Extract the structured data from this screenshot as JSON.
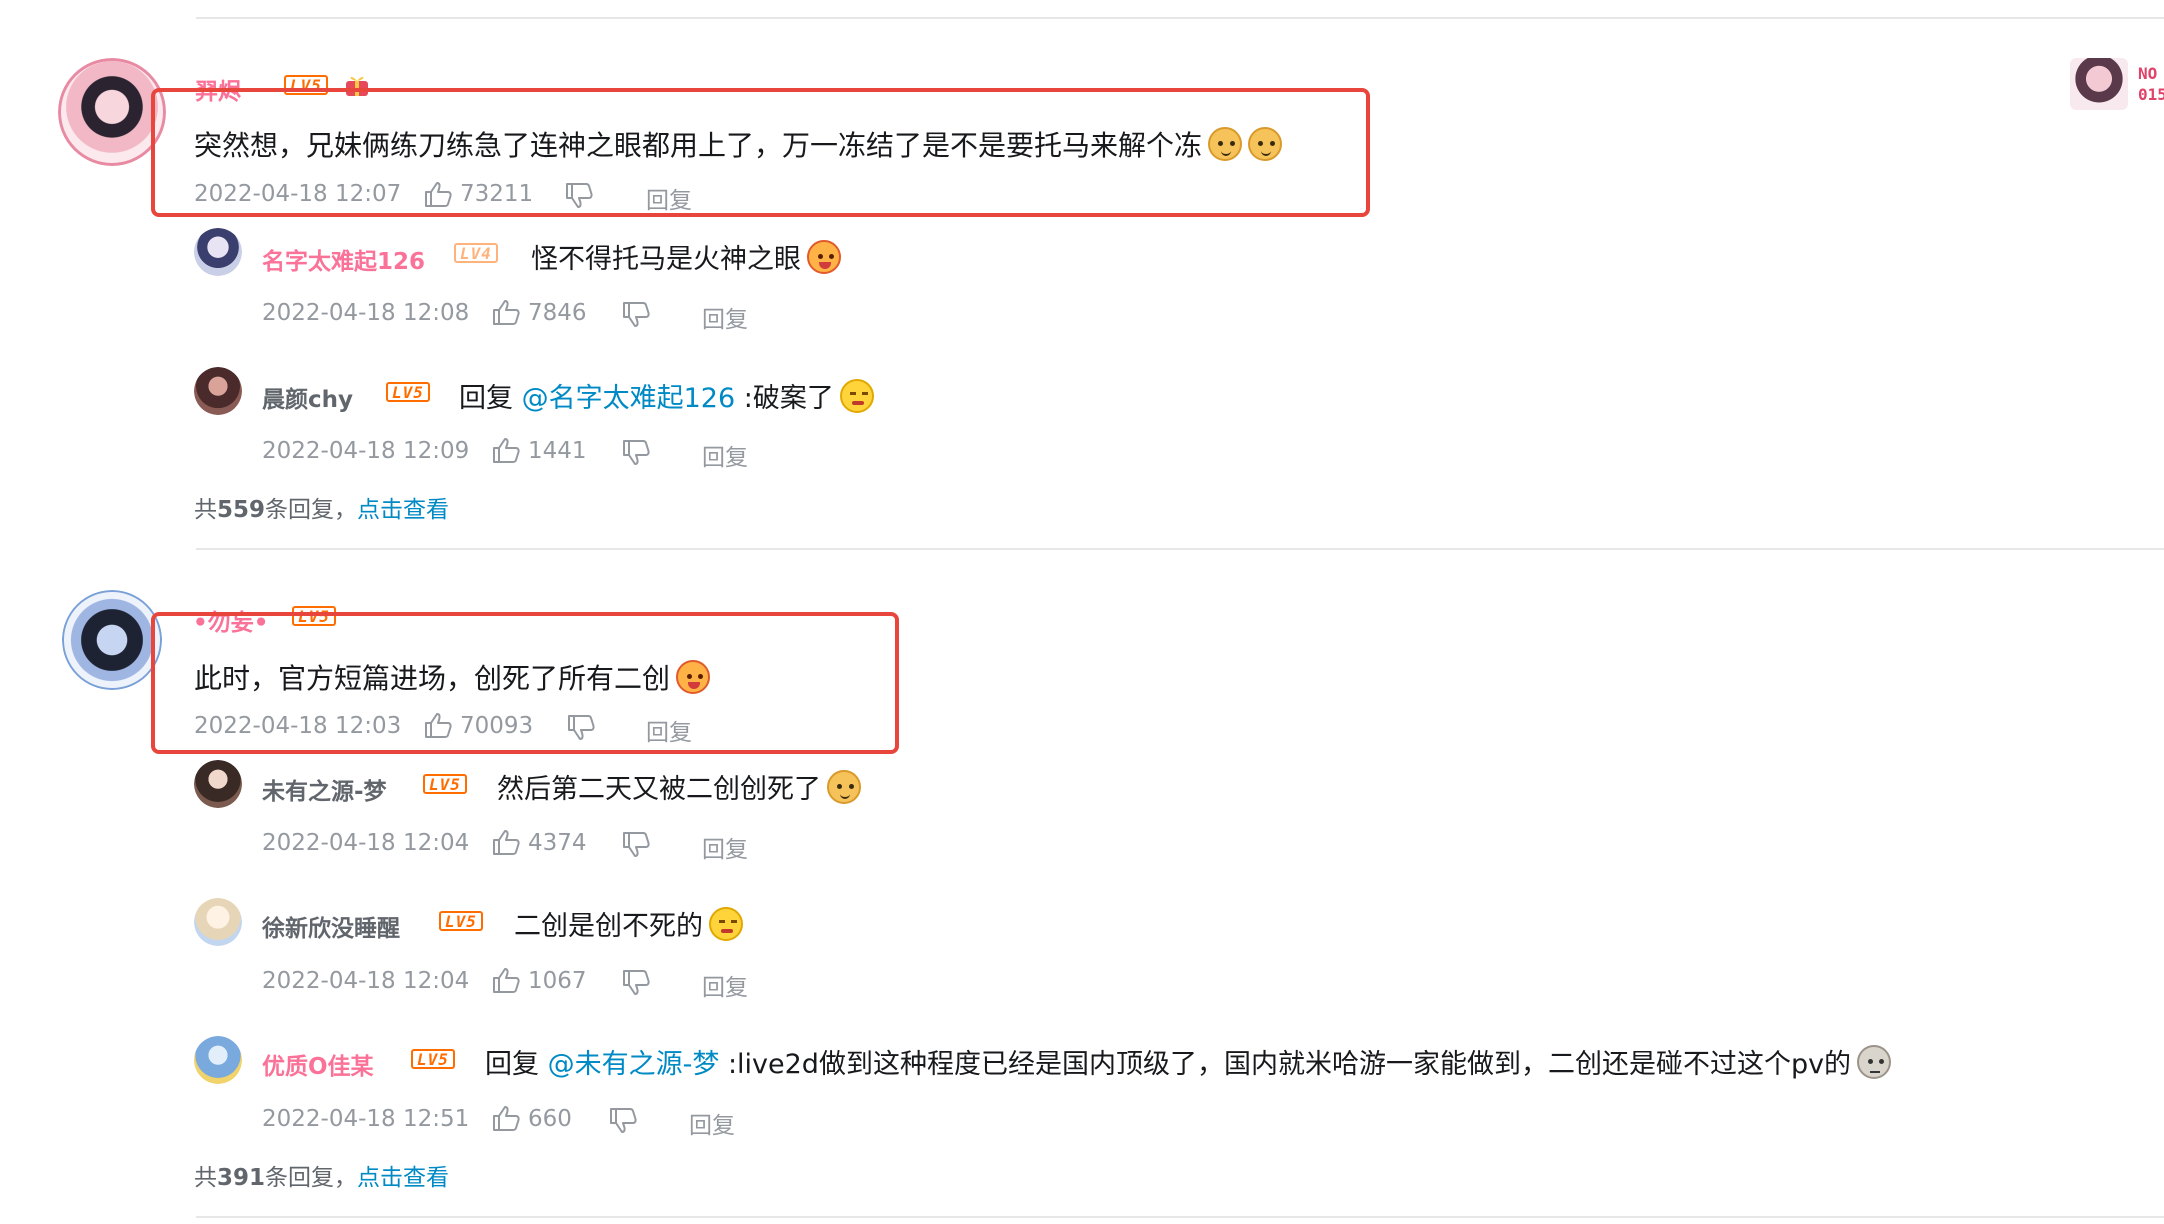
{
  "comments": [
    {
      "username": "羿烬",
      "level": "LV5",
      "text": "突然想，兄妹俩练刀练急了连神之眼都用上了，万一冻结了是不是要托马来解个冻",
      "time": "2022-04-18 12:07",
      "likes": "73211",
      "reply_label": "回复",
      "replies": [
        {
          "username": "名字太难起126",
          "level": "LV4",
          "text": "怪不得托马是火神之眼",
          "time": "2022-04-18 12:08",
          "likes": "7846",
          "reply_label": "回复"
        },
        {
          "username": "晨颜chy",
          "level": "LV5",
          "reply_prefix": "回复",
          "mention": "@名字太难起126",
          "text": ":破案了",
          "time": "2022-04-18 12:09",
          "likes": "1441",
          "reply_label": "回复"
        }
      ],
      "summary": {
        "prefix": "共",
        "count": "559",
        "suffix": "条回复，",
        "link": "点击查看"
      }
    },
    {
      "username": "•勿妄•",
      "level": "LV5",
      "text": "此时，官方短篇进场，创死了所有二创",
      "time": "2022-04-18 12:03",
      "likes": "70093",
      "reply_label": "回复",
      "replies": [
        {
          "username": "未有之源-梦",
          "level": "LV5",
          "text": "然后第二天又被二创创死了",
          "time": "2022-04-18 12:04",
          "likes": "4374",
          "reply_label": "回复"
        },
        {
          "username": "徐新欣没睡醒",
          "level": "LV5",
          "text": "二创是创不死的",
          "time": "2022-04-18 12:04",
          "likes": "1067",
          "reply_label": "回复"
        },
        {
          "username": "优质O佳某",
          "level": "LV5",
          "reply_prefix": "回复",
          "mention": "@未有之源-梦",
          "text": ":live2d做到这种程度已经是国内顶级了，国内就米哈游一家能做到，二创还是碰不过这个pv的",
          "time": "2022-04-18 12:51",
          "likes": "660",
          "reply_label": "回复"
        }
      ],
      "summary": {
        "prefix": "共",
        "count": "391",
        "suffix": "条回复，",
        "link": "点击查看"
      }
    }
  ],
  "side_card": {
    "line1": "NO",
    "line2": "015"
  },
  "colors": {
    "highlight": "#e8453c",
    "link": "#008ac5",
    "pink_name": "#fb7299",
    "meta": "#9499a0"
  }
}
